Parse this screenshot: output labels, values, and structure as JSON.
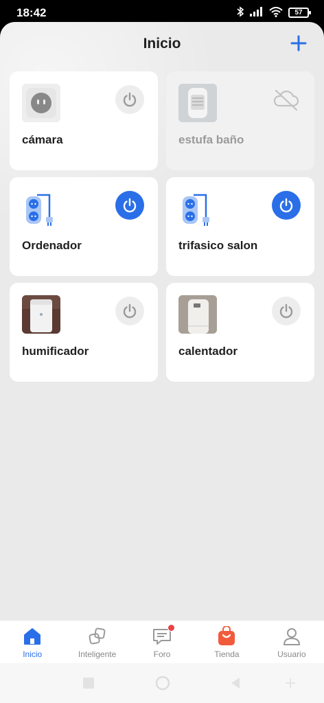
{
  "status": {
    "time": "18:42",
    "battery": "57"
  },
  "header": {
    "title": "Inicio",
    "add_icon": "plus-icon"
  },
  "devices": [
    {
      "name": "cámara",
      "thumb": "socket-icon",
      "state": "off",
      "online": true
    },
    {
      "name": "estufa baño",
      "thumb": "heater-photo",
      "state": "offline",
      "online": false
    },
    {
      "name": "Ordenador",
      "thumb": "power-strip-icon",
      "state": "on",
      "online": true
    },
    {
      "name": "trifasico salon",
      "thumb": "power-strip-icon",
      "state": "on",
      "online": true
    },
    {
      "name": "humificador",
      "thumb": "humidifier-photo",
      "state": "off",
      "online": true
    },
    {
      "name": "calentador",
      "thumb": "water-heater-photo",
      "state": "off",
      "online": true
    }
  ],
  "tabs": [
    {
      "label": "Inicio",
      "icon": "home-icon",
      "active": true
    },
    {
      "label": "Inteligente",
      "icon": "smart-scenes-icon",
      "active": false
    },
    {
      "label": "Foro",
      "icon": "forum-icon",
      "active": false,
      "badge": true
    },
    {
      "label": "Tienda",
      "icon": "shopping-bag-icon",
      "active": false
    },
    {
      "label": "Usuario",
      "icon": "user-icon",
      "active": false
    }
  ],
  "colors": {
    "accent": "#2a6fe8",
    "background": "#eaeaea",
    "badge": "#e84343",
    "shop": "#f25a3c"
  }
}
